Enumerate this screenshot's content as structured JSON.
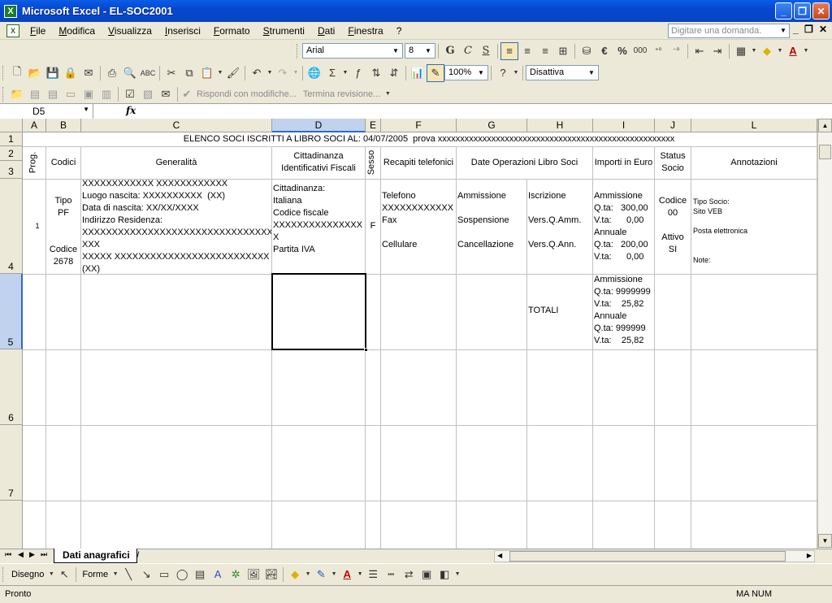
{
  "window": {
    "title": "Microsoft Excel - EL-SOC2001"
  },
  "menu": {
    "items": [
      "File",
      "Modifica",
      "Visualizza",
      "Inserisci",
      "Formato",
      "Strumenti",
      "Dati",
      "Finestra",
      "?"
    ],
    "help_placeholder": "Digitare una domanda."
  },
  "format_toolbar": {
    "font": "Arial",
    "size": "8",
    "bold": "G",
    "italic": "C",
    "underline": "S",
    "currency": "€",
    "percent": "%",
    "thousands": "000"
  },
  "standard_toolbar": {
    "zoom": "100%",
    "disattiva": "Disattiva"
  },
  "review_toolbar": {
    "reply": "Rispondi con modifiche...",
    "end_review": "Termina revisione..."
  },
  "formula_bar": {
    "name_box": "D5",
    "fx": "fx",
    "content": ""
  },
  "columns": [
    {
      "letter": "A"
    },
    {
      "letter": "B"
    },
    {
      "letter": "C"
    },
    {
      "letter": "D"
    },
    {
      "letter": "E"
    },
    {
      "letter": "F"
    },
    {
      "letter": "G"
    },
    {
      "letter": "H"
    },
    {
      "letter": "I"
    },
    {
      "letter": "J"
    },
    {
      "letter": "L"
    }
  ],
  "rows": [
    "1",
    "2",
    "3",
    "4",
    "5",
    "6",
    "7"
  ],
  "sheet": {
    "r1": "ELENCO SOCI ISCRITTI A LIBRO SOCI AL: 04/07/2005  prova xxxxxxxxxxxxxxxxxxxxxxxxxxxxxxxxxxxxxxxxxxxxxxxxxxxxx",
    "h_prog": "Prog.",
    "h_codici": "Codici",
    "h_generalita": "Generalità",
    "h_cittadinanza": "Cittadinanza\nIdentificativi Fiscali",
    "h_sesso": "Sesso",
    "h_recapiti": "Recapiti telefonici",
    "h_date": "Date Operazioni Libro Soci",
    "h_importi": "Importi in Euro",
    "h_status": "Status\nSocio",
    "h_annotazioni": "Annotazioni",
    "r4_a": "1",
    "r4_b": "Tipo\nPF\n\n\nCodice\n2678",
    "r4_c": "XXXXXXXXXXXX XXXXXXXXXXXX\nLuogo nascita: XXXXXXXXXX  (XX)\nData di nascita: XX/XX/XXXX\nIndirizzo Residenza:\nXXXXXXXXXXXXXXXXXXXXXXXXXXXXXXXXXX\nXXX\nXXXXX XXXXXXXXXXXXXXXXXXXXXXXXXX\n(XX)",
    "r4_d": "Cittadinanza:\nItaliana\nCodice fiscale\nXXXXXXXXXXXXXXX\nX\nPartita IVA",
    "r4_e": "F",
    "r4_f": "Telefono\nXXXXXXXXXXXX\nFax\n\nCellulare",
    "r4_g": "Ammissione\n\nSospensione\n\nCancellazione",
    "r4_h": "Iscrizione\n\nVers.Q.Amm.\n\nVers.Q.Ann.",
    "r4_i": "Ammissione\nQ.ta:   300,00\nV.ta:      0,00\nAnnuale\nQ.ta:   200,00\nV.ta:      0,00",
    "r4_j": "Codice\n00\n\nAttivo\nSI",
    "r4_l": "Tipo Socio:\nSito VEB\n\nPosta elettronica\n\n\nNote:",
    "r5_h": "TOTALI",
    "r5_i": "Ammissione\nQ.ta: 9999999\nV.ta:    25,82\nAnnuale\nQ.ta: 999999\nV.ta:    25,82"
  },
  "tabs": {
    "active": "Dati anagrafici",
    "slash": "/"
  },
  "draw_toolbar": {
    "disegno": "Disegno",
    "forme": "Forme"
  },
  "status": {
    "text": "Pronto",
    "keys": "MA NUM"
  }
}
